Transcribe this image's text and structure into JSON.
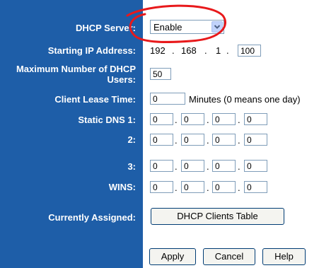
{
  "labels": {
    "dhcp_server": "DHCP Server:",
    "starting_ip": "Starting IP Address:",
    "max_users": "Maximum Number of DHCP Users:",
    "lease_time": "Client Lease Time:",
    "static_dns1": "Static DNS 1:",
    "dns2": "2:",
    "dns3": "3:",
    "wins": "WINS:",
    "currently_assigned": "Currently Assigned:"
  },
  "dhcp_server": {
    "selected": "Enable"
  },
  "starting_ip": {
    "prefix_octets": [
      "192",
      "168",
      "1"
    ],
    "last_octet": "100"
  },
  "max_users": "50",
  "lease_time": {
    "value": "0",
    "note": "Minutes (0 means one day)"
  },
  "dns1": [
    "0",
    "0",
    "0",
    "0"
  ],
  "dns2": [
    "0",
    "0",
    "0",
    "0"
  ],
  "dns3": [
    "0",
    "0",
    "0",
    "0"
  ],
  "wins": [
    "0",
    "0",
    "0",
    "0"
  ],
  "buttons": {
    "dhcp_clients_table": "DHCP Clients Table",
    "apply": "Apply",
    "cancel": "Cancel",
    "help": "Help"
  },
  "annotation": {
    "color": "#e8191b"
  }
}
